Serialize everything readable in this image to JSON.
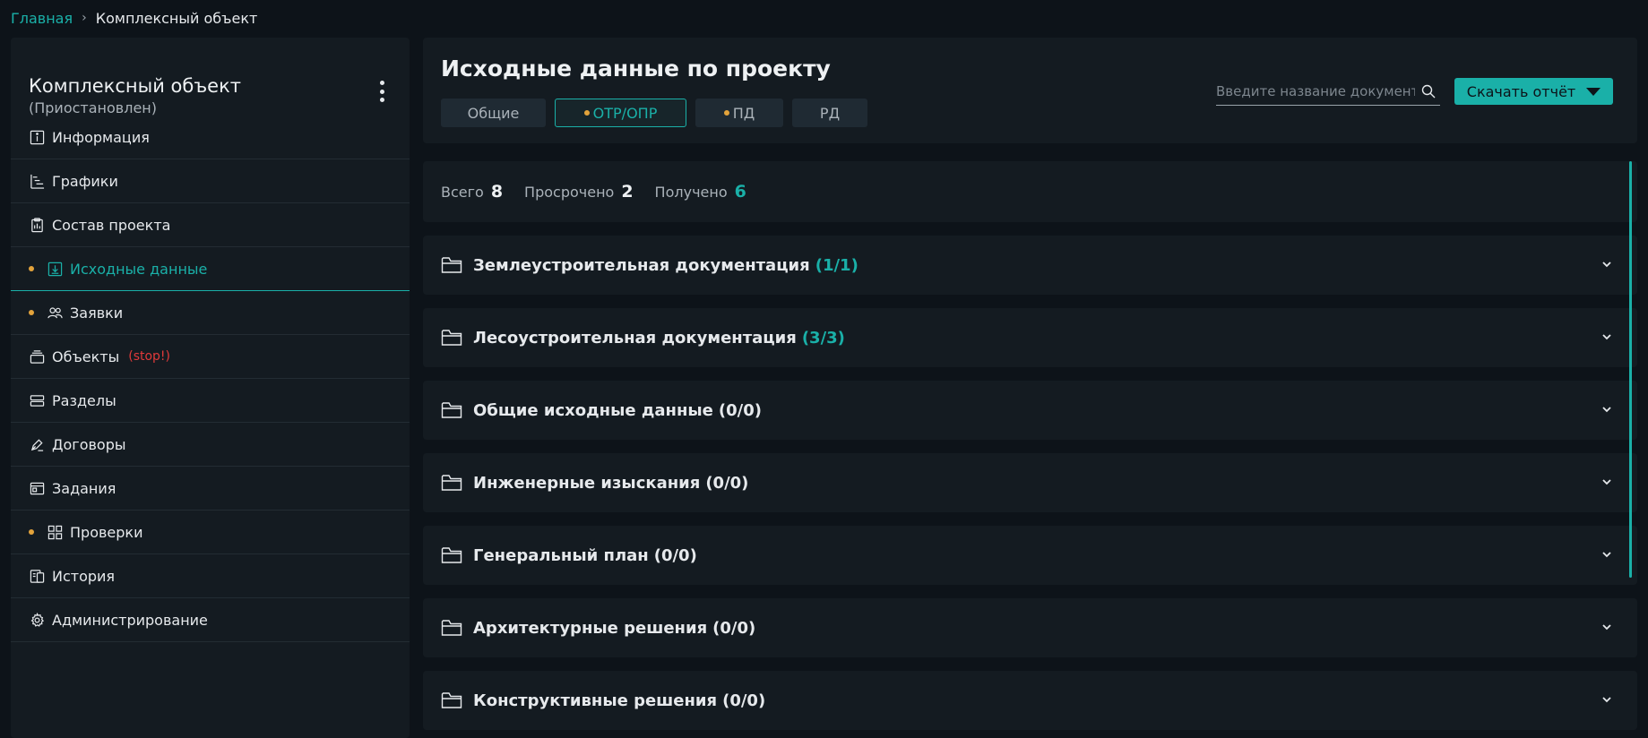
{
  "breadcrumb": {
    "home": "Главная",
    "separator": "›",
    "current": "Комплексный объект"
  },
  "sidebar": {
    "title": "Комплексный объект",
    "status": "(Приостановлен)",
    "items": [
      {
        "label": "Информация",
        "icon": "info-icon"
      },
      {
        "label": "Графики",
        "icon": "gantt-icon"
      },
      {
        "label": "Состав проекта",
        "icon": "clipboard-icon"
      },
      {
        "label": "Исходные данные",
        "icon": "download-box-icon",
        "active": true,
        "dot": true
      },
      {
        "label": "Заявки",
        "icon": "users-icon",
        "dot": true
      },
      {
        "label": "Объекты",
        "icon": "layers-icon",
        "flag": "(stop!)"
      },
      {
        "label": "Разделы",
        "icon": "sections-icon"
      },
      {
        "label": "Договоры",
        "icon": "pen-icon"
      },
      {
        "label": "Задания",
        "icon": "window-icon"
      },
      {
        "label": "Проверки",
        "icon": "grid-icon",
        "dot": true
      },
      {
        "label": "История",
        "icon": "history-icon"
      },
      {
        "label": "Администрирование",
        "icon": "gear-icon"
      }
    ]
  },
  "header": {
    "title": "Исходные данные по проекту",
    "tabs": [
      {
        "label": "Общие",
        "dot": false,
        "active": false
      },
      {
        "label": "ОТР/ОПР",
        "dot": true,
        "active": true
      },
      {
        "label": "ПД",
        "dot": true,
        "active": false
      },
      {
        "label": "РД",
        "dot": false,
        "active": false
      }
    ],
    "search_placeholder": "Введите название документа",
    "download_label": "Скачать отчёт"
  },
  "stats": {
    "total_label": "Всего",
    "total": "8",
    "overdue_label": "Просрочено",
    "overdue": "2",
    "received_label": "Получено",
    "received": "6"
  },
  "sections": [
    {
      "title": "Землеустроительная документация",
      "count": "(1/1)",
      "highlight": true
    },
    {
      "title": "Лесоустроительная документация",
      "count": "(3/3)",
      "highlight": true
    },
    {
      "title": "Общие исходные данные",
      "count": "(0/0)",
      "highlight": false
    },
    {
      "title": "Инженерные изыскания",
      "count": "(0/0)",
      "highlight": false
    },
    {
      "title": "Генеральный план",
      "count": "(0/0)",
      "highlight": false
    },
    {
      "title": "Архитектурные решения",
      "count": "(0/0)",
      "highlight": false
    },
    {
      "title": "Конструктивные решения",
      "count": "(0/0)",
      "highlight": false
    }
  ],
  "colors": {
    "accent": "#1ab0a8",
    "dot": "#e3a33b",
    "danger": "#e03a3a",
    "background": "#0d1319",
    "panel": "#141b21"
  }
}
